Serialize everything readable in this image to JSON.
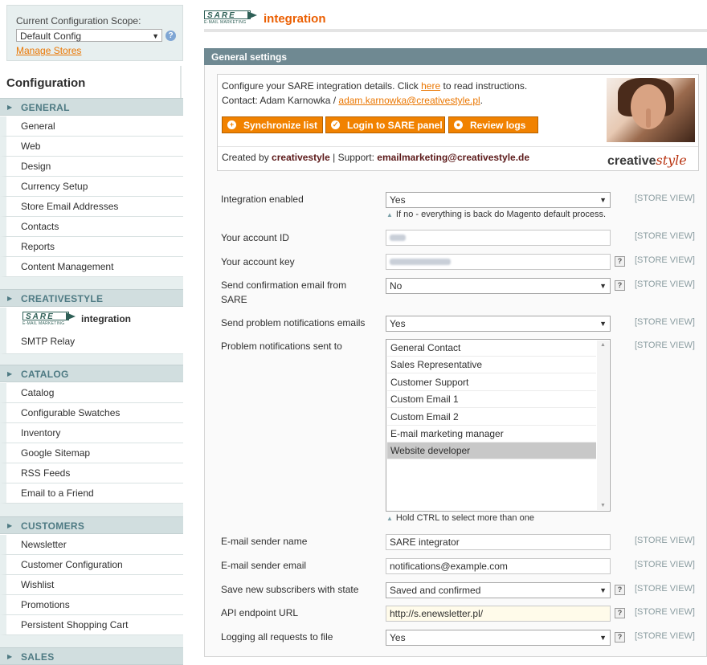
{
  "scope": {
    "label": "Current Configuration Scope:",
    "selected": "Default Config",
    "manage_link": "Manage Stores"
  },
  "sidebar": {
    "title": "Configuration",
    "sections": [
      {
        "label": "GENERAL",
        "items": [
          "General",
          "Web",
          "Design",
          "Currency Setup",
          "Store Email Addresses",
          "Contacts",
          "Reports",
          "Content Management"
        ]
      },
      {
        "label": "CREATIVESTYLE",
        "items": [
          "integration",
          "SMTP Relay"
        ]
      },
      {
        "label": "CATALOG",
        "items": [
          "Catalog",
          "Configurable Swatches",
          "Inventory",
          "Google Sitemap",
          "RSS Feeds",
          "Email to a Friend"
        ]
      },
      {
        "label": "CUSTOMERS",
        "items": [
          "Newsletter",
          "Customer Configuration",
          "Wishlist",
          "Promotions",
          "Persistent Shopping Cart"
        ]
      },
      {
        "label": "SALES",
        "items": []
      }
    ]
  },
  "logo": {
    "brand": "SARE",
    "tagline": "E-MAIL MARKETING"
  },
  "page": {
    "title": "integration"
  },
  "fieldset": {
    "title": "General settings",
    "info": {
      "line1_pre": "Configure your SARE integration details. Click ",
      "line1_link": "here",
      "line1_post": " to read instructions.",
      "line2_pre": "Contact: Adam Karnowka / ",
      "line2_link": "adam.karnowka@creativestyle.pl",
      "line2_post": ".",
      "buttons": [
        "Synchronize list",
        "Login to SARE panel",
        "Review logs"
      ],
      "credits_pre": "Created by ",
      "credits_company": "creativestyle",
      "credits_mid": " | Support: ",
      "credits_email": "emailmarketing@creativestyle.de",
      "logo_main": "creative",
      "logo_italic": "style"
    }
  },
  "fields": {
    "integration_enabled": {
      "label": "Integration enabled",
      "value": "Yes",
      "note": "If no - everything is back do Magento default process.",
      "scope": "[STORE VIEW]"
    },
    "account_id": {
      "label": "Your account ID",
      "value": "",
      "scope": "[STORE VIEW]"
    },
    "account_key": {
      "label": "Your account key",
      "value": "",
      "scope": "[STORE VIEW]"
    },
    "send_confirmation": {
      "label": "Send confirmation email from SARE",
      "value": "No",
      "scope": "[STORE VIEW]"
    },
    "send_problem": {
      "label": "Send problem notifications emails",
      "value": "Yes",
      "scope": "[STORE VIEW]"
    },
    "problem_to": {
      "label": "Problem notifications sent to",
      "options": [
        "General Contact",
        "Sales Representative",
        "Customer Support",
        "Custom Email 1",
        "Custom Email 2",
        "E-mail marketing manager",
        "Website developer"
      ],
      "selected": "Website developer",
      "note": "Hold CTRL to select more than one",
      "scope": "[STORE VIEW]"
    },
    "sender_name": {
      "label": "E-mail sender name",
      "value": "SARE integrator",
      "scope": "[STORE VIEW]"
    },
    "sender_email": {
      "label": "E-mail sender email",
      "value": "notifications@example.com",
      "scope": "[STORE VIEW]"
    },
    "subscriber_state": {
      "label": "Save new subscribers with state",
      "value": "Saved and confirmed",
      "scope": "[STORE VIEW]"
    },
    "api_endpoint": {
      "label": "API endpoint URL",
      "value": "http://s.enewsletter.pl/",
      "scope": "[STORE VIEW]"
    },
    "logging": {
      "label": "Logging all requests to file",
      "value": "Yes",
      "scope": "[STORE VIEW]"
    }
  }
}
